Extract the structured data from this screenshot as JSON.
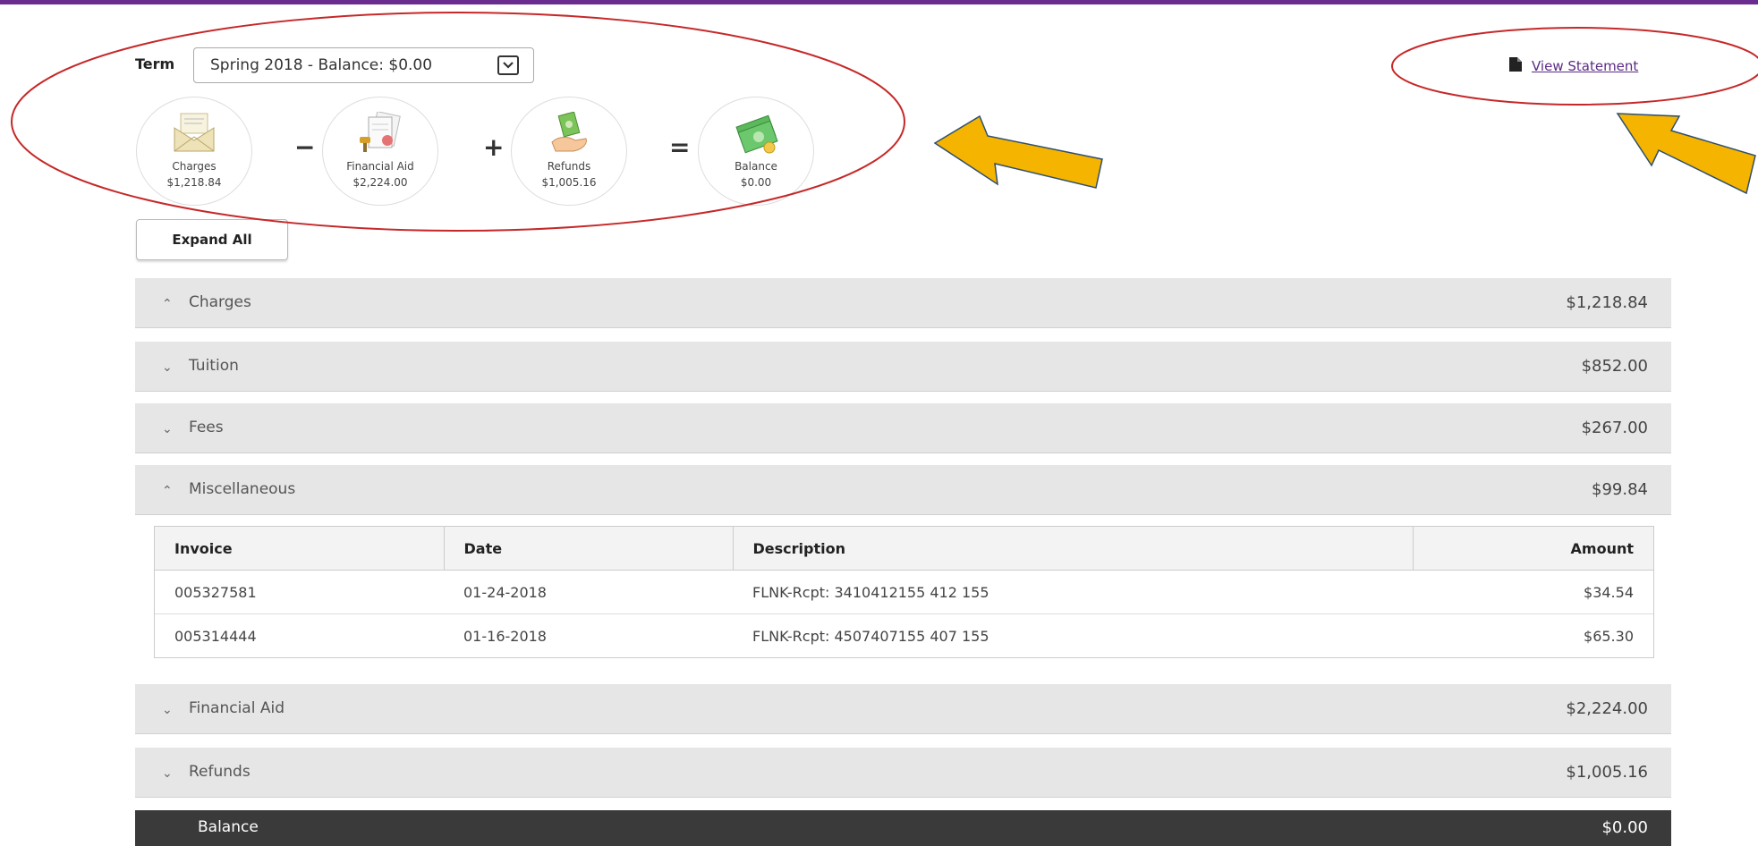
{
  "term": {
    "label": "Term",
    "selected": "Spring 2018 - Balance: $0.00"
  },
  "summary": [
    {
      "label": "Charges",
      "amount": "$1,218.84",
      "icon": "envelope-icon"
    },
    {
      "label": "Financial Aid",
      "amount": "$2,224.00",
      "icon": "documents-icon"
    },
    {
      "label": "Refunds",
      "amount": "$1,005.16",
      "icon": "money-hand-icon"
    },
    {
      "label": "Balance",
      "amount": "$0.00",
      "icon": "cash-icon"
    }
  ],
  "operators": [
    "−",
    "+",
    "="
  ],
  "expand_all": "Expand All",
  "view_statement": "View Statement",
  "sections": [
    {
      "title": "Charges",
      "amount": "$1,218.84",
      "expanded": true
    },
    {
      "title": "Tuition",
      "amount": "$852.00",
      "expanded": false
    },
    {
      "title": "Fees",
      "amount": "$267.00",
      "expanded": false
    },
    {
      "title": "Miscellaneous",
      "amount": "$99.84",
      "expanded": true
    },
    {
      "title": "Financial Aid",
      "amount": "$2,224.00",
      "expanded": false
    },
    {
      "title": "Refunds",
      "amount": "$1,005.16",
      "expanded": false
    }
  ],
  "chevrons": {
    "up": "⌃",
    "down": "⌄"
  },
  "table": {
    "headers": [
      "Invoice",
      "Date",
      "Description",
      "Amount"
    ],
    "rows": [
      [
        "005327581",
        "01-24-2018",
        "FLNK-Rcpt: 3410412155 412 155",
        "$34.54"
      ],
      [
        "005314444",
        "01-16-2018",
        "FLNK-Rcpt: 4507407155 407 155",
        "$65.30"
      ]
    ]
  },
  "balance": {
    "title": "Balance",
    "amount": "$0.00"
  },
  "colors": {
    "top_bar": "#6a2c8f",
    "annotation_ellipse": "#c62828",
    "annotation_arrow": "#f4b400"
  }
}
